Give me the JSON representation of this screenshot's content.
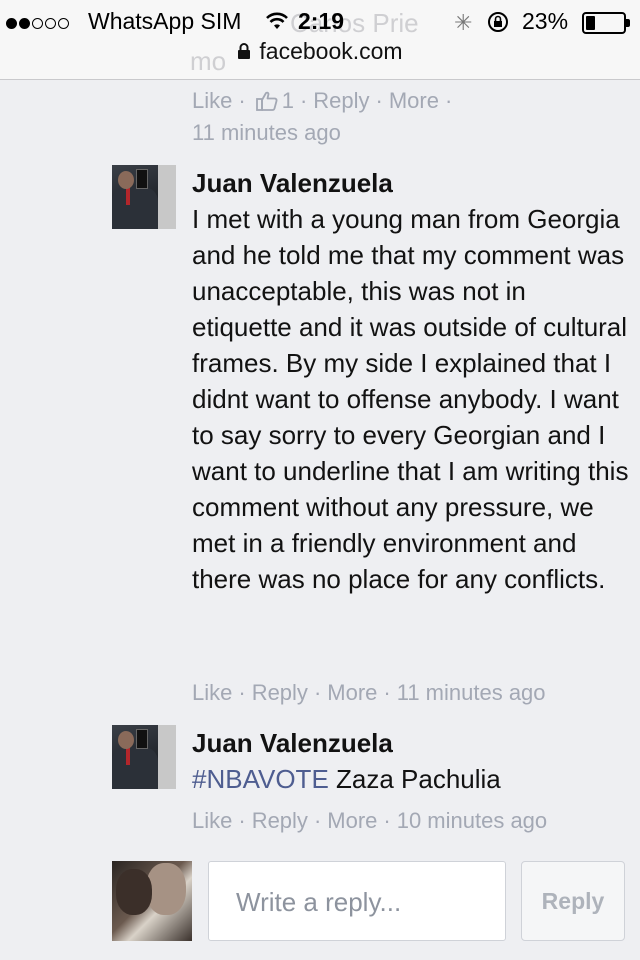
{
  "status_bar": {
    "carrier": "WhatsApp SIM",
    "time": "2:19",
    "battery": "23%",
    "battery_level": 0.23
  },
  "url_bar": {
    "domain": "facebook.com"
  },
  "background_ghost": {
    "name_fragment": "Carlos Prie",
    "text_fragment": "mo"
  },
  "prev_comment_actions": {
    "like": "Like",
    "like_count": "1",
    "reply": "Reply",
    "more": "More",
    "time": "11 minutes ago"
  },
  "comments": [
    {
      "author": "Juan Valenzuela",
      "text": "I met with a young man from Georgia and he told me that my comment was unacceptable, this was not in etiquette and it was outside of cultural frames. By my side I explained that I didnt want to offense anybody. I want to say sorry to every Georgian and I want to underline that I am writing this comment without any pressure, we met in a friendly environment and there was no place for any conflicts.",
      "like": "Like",
      "reply": "Reply",
      "more": "More",
      "time": "11 minutes ago"
    },
    {
      "author": "Juan Valenzuela",
      "hashtag": "#NBAVOTE",
      "text": " Zaza Pachulia",
      "like": "Like",
      "reply": "Reply",
      "more": "More",
      "time": "10 minutes ago"
    }
  ],
  "reply_box": {
    "placeholder": "Write a reply...",
    "button": "Reply"
  },
  "colors": {
    "meta_gray": "#a3a8b4",
    "hashtag_blue": "#4e5d90",
    "background": "#eeeff2"
  }
}
